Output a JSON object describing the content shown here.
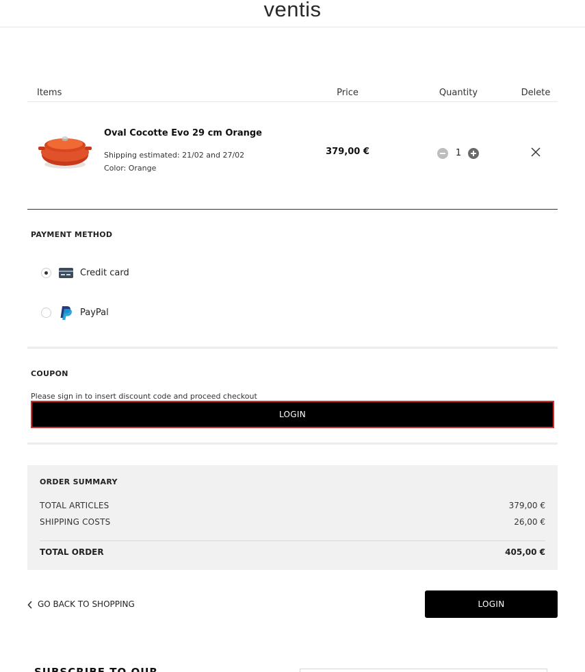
{
  "brand": {
    "logo": "ventis"
  },
  "cart": {
    "headers": {
      "items": "Items",
      "price": "Price",
      "quantity": "Quantity",
      "delete": "Delete"
    },
    "item": {
      "name": "Oval Cocotte Evo 29 cm Orange",
      "shipping": "Shipping estimated: 21/02 and 27/02",
      "color": "Color: Orange",
      "price": "379,00 €",
      "quantity": "1",
      "image_color": "#d7431f"
    }
  },
  "payment": {
    "title": "PAYMENT METHOD",
    "options": [
      {
        "label": "Credit card",
        "icon": "credit-card-icon",
        "selected": true
      },
      {
        "label": "PayPal",
        "icon": "paypal-icon",
        "selected": false
      }
    ]
  },
  "coupon": {
    "title": "COUPON",
    "note": "Please sign in to insert discount code and proceed checkout",
    "login_label": "LOGIN"
  },
  "summary": {
    "title": "ORDER SUMMARY",
    "total_articles_label": "TOTAL ARTICLES",
    "total_articles_value": "379,00 €",
    "shipping_label": "SHIPPING COSTS",
    "shipping_value": "26,00 €",
    "total_label": "TOTAL ORDER",
    "total_value": "405,00 €"
  },
  "footer_actions": {
    "back_label": "GO BACK TO SHOPPING",
    "login_label": "LOGIN"
  },
  "newsletter": {
    "title": "SUBSCRIBE TO OUR"
  },
  "colors": {
    "accent": "#000000",
    "highlight_border": "#d62b2b",
    "summary_bg": "#f1f1f1"
  }
}
